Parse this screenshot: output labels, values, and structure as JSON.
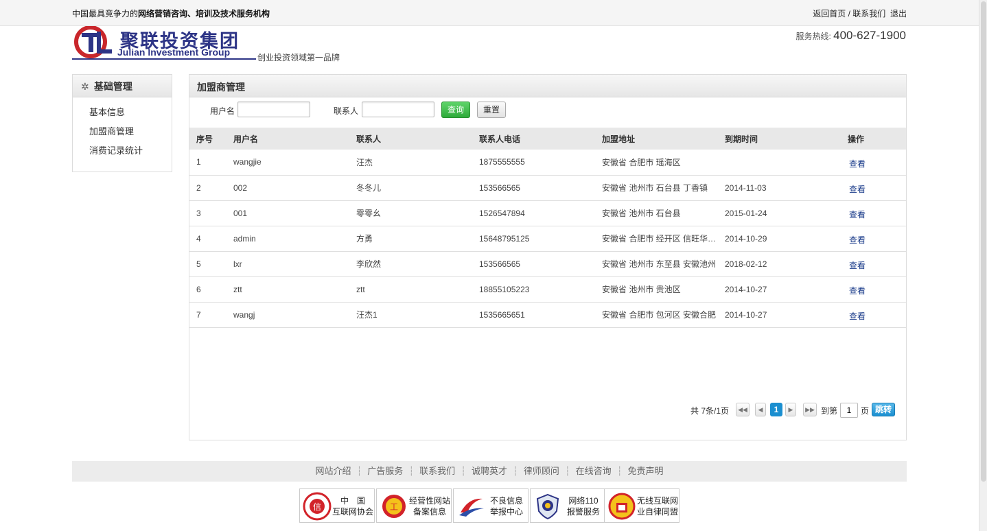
{
  "topbar": {
    "slogan_prefix": "中国最具竞争力的",
    "slogan_bold": "网络营销咨询、培训及技术服务机构",
    "link_home": "返回首页",
    "link_sep": "/",
    "link_contact": "联系我们",
    "link_logout": "退出"
  },
  "header": {
    "logo_cn": "聚联投资集团",
    "logo_en": "Julian Investment Group",
    "tagline": "创业投资领域第一品牌",
    "hotline_label": "服务热线:",
    "hotline_number": "400-627-1900"
  },
  "sidebar": {
    "title": "基础管理",
    "items": [
      {
        "label": "基本信息"
      },
      {
        "label": "加盟商管理"
      },
      {
        "label": "消费记录统计"
      }
    ]
  },
  "main": {
    "title": "加盟商管理",
    "search": {
      "username_label": "用户名",
      "username_value": "",
      "contact_label": "联系人",
      "contact_value": "",
      "query_button": "查询",
      "reset_button": "重置"
    },
    "table": {
      "headers": [
        "序号",
        "用户名",
        "联系人",
        "联系人电话",
        "加盟地址",
        "到期时间",
        "操作"
      ],
      "rows": [
        {
          "no": "1",
          "username": "wangjie",
          "contact": "汪杰",
          "phone": "1875555555",
          "address": "安徽省 合肥市 瑶海区",
          "expire": "",
          "action": "查看"
        },
        {
          "no": "2",
          "username": "002",
          "contact": "冬冬儿",
          "phone": "153566565",
          "address": "安徽省 池州市 石台县 丁香镇",
          "expire": "2014-11-03",
          "action": "查看"
        },
        {
          "no": "3",
          "username": "001",
          "contact": "零零幺",
          "phone": "1526547894",
          "address": "安徽省 池州市 石台县",
          "expire": "2015-01-24",
          "action": "查看"
        },
        {
          "no": "4",
          "username": "admin",
          "contact": "方勇",
          "phone": "15648795125",
          "address": "安徽省 合肥市 经开区 信旺华府...",
          "expire": "2014-10-29",
          "action": "查看"
        },
        {
          "no": "5",
          "username": "lxr",
          "contact": "李欣然",
          "phone": "153566565",
          "address": "安徽省 池州市 东至县 安徽池州",
          "expire": "2018-02-12",
          "action": "查看"
        },
        {
          "no": "6",
          "username": "ztt",
          "contact": "ztt",
          "phone": "18855105223",
          "address": "安徽省 池州市 贵池区",
          "expire": "2014-10-27",
          "action": "查看"
        },
        {
          "no": "7",
          "username": "wangj",
          "contact": "汪杰1",
          "phone": "1535665651",
          "address": "安徽省 合肥市 包河区 安徽合肥",
          "expire": "2014-10-27",
          "action": "查看"
        }
      ]
    },
    "pager": {
      "summary": "共 7条/1页",
      "current_page": "1",
      "goto_label": "到第",
      "goto_value": "1",
      "page_unit": "页",
      "go_button": "跳转"
    }
  },
  "footer": {
    "links": [
      "网站介绍",
      "广告服务",
      "联系我们",
      "诚聘英才",
      "律师顾问",
      "在线咨询",
      "免责声明"
    ],
    "badges": [
      {
        "line1": "中　国",
        "line2": "互联网协会",
        "icon": "itrust-seal-icon"
      },
      {
        "line1": "经营性网站",
        "line2": "备案信息",
        "icon": "business-license-icon"
      },
      {
        "line1": "不良信息",
        "line2": "举报中心",
        "icon": "report-center-icon"
      },
      {
        "line1": "网络110",
        "line2": "报警服务",
        "icon": "police-badge-icon"
      },
      {
        "line1": "无线互联网",
        "line2": "业自律同盟",
        "icon": "wireless-alliance-icon"
      }
    ]
  }
}
